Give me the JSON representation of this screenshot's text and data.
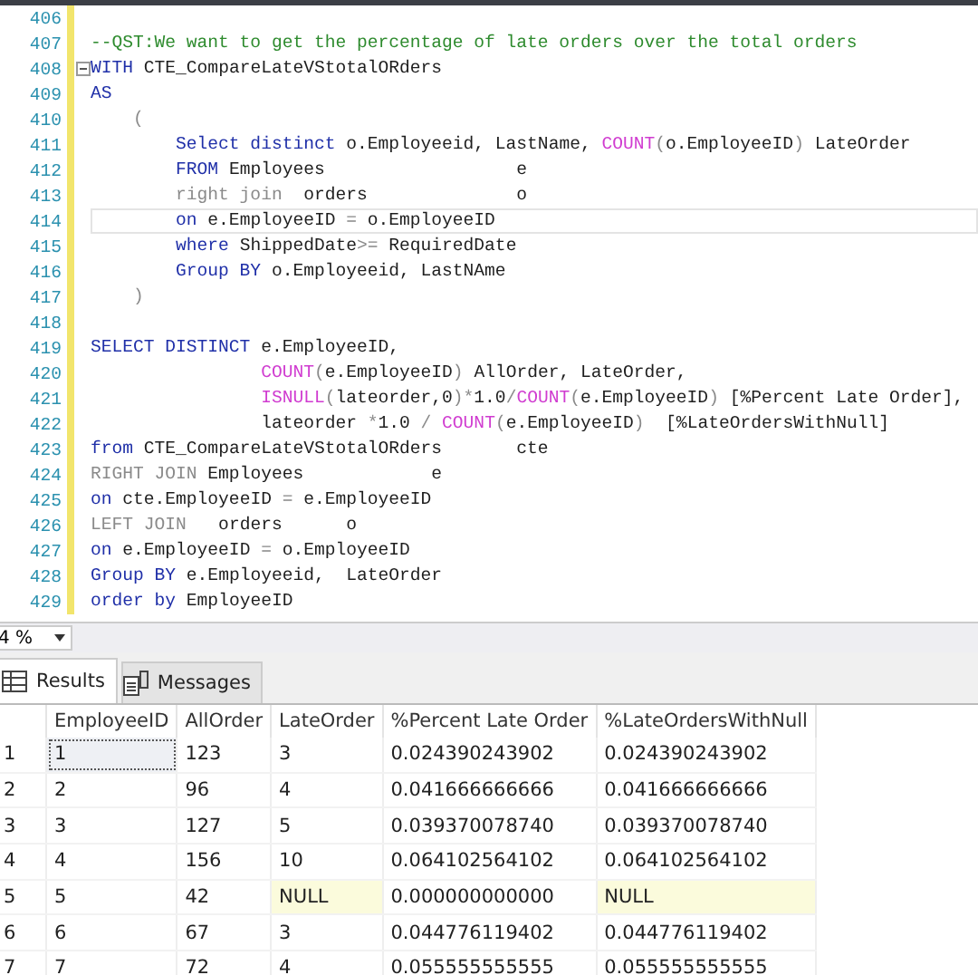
{
  "editor": {
    "lines": [
      {
        "number": "406",
        "fold": false,
        "current": false
      },
      {
        "number": "407",
        "fold": false,
        "current": false,
        "tokens": [
          {
            "kind": "comment",
            "text": "--QST:We want to get the percentage of late orders over the total orders"
          }
        ]
      },
      {
        "number": "408",
        "fold": true,
        "current": false,
        "tokens": [
          {
            "kind": "keyword",
            "text": "WITH"
          },
          {
            "kind": "plain",
            "text": " CTE_CompareLateVStotalORders"
          }
        ]
      },
      {
        "number": "409",
        "fold": false,
        "current": false,
        "tokens": [
          {
            "kind": "keyword",
            "text": "AS"
          }
        ]
      },
      {
        "number": "410",
        "fold": false,
        "current": false,
        "tokens": [
          {
            "kind": "op",
            "text": "    ("
          }
        ]
      },
      {
        "number": "411",
        "fold": false,
        "current": false,
        "tokens": [
          {
            "kind": "keyword",
            "text": "        Select distinct"
          },
          {
            "kind": "plain",
            "text": " o.Employeeid, LastName, "
          },
          {
            "kind": "function",
            "text": "COUNT"
          },
          {
            "kind": "op",
            "text": "("
          },
          {
            "kind": "plain",
            "text": "o.EmployeeID"
          },
          {
            "kind": "op",
            "text": ")"
          },
          {
            "kind": "plain",
            "text": " LateOrder"
          }
        ]
      },
      {
        "number": "412",
        "fold": false,
        "current": false,
        "tokens": [
          {
            "kind": "keyword",
            "text": "        FROM"
          },
          {
            "kind": "plain",
            "text": " Employees                  e"
          }
        ]
      },
      {
        "number": "413",
        "fold": false,
        "current": false,
        "tokens": [
          {
            "kind": "op",
            "text": "        right join"
          },
          {
            "kind": "plain",
            "text": "  orders              o"
          }
        ]
      },
      {
        "number": "414",
        "fold": false,
        "current": true,
        "tokens": [
          {
            "kind": "keyword",
            "text": "        on"
          },
          {
            "kind": "plain",
            "text": " e.EmployeeID "
          },
          {
            "kind": "op",
            "text": "="
          },
          {
            "kind": "plain",
            "text": " o.EmployeeID"
          }
        ]
      },
      {
        "number": "415",
        "fold": false,
        "current": false,
        "tokens": [
          {
            "kind": "keyword",
            "text": "        where"
          },
          {
            "kind": "plain",
            "text": " ShippedDate"
          },
          {
            "kind": "op",
            "text": ">="
          },
          {
            "kind": "plain",
            "text": " RequiredDate"
          }
        ]
      },
      {
        "number": "416",
        "fold": false,
        "current": false,
        "tokens": [
          {
            "kind": "keyword",
            "text": "        Group BY"
          },
          {
            "kind": "plain",
            "text": " o.Employeeid, LastNAme"
          }
        ]
      },
      {
        "number": "417",
        "fold": false,
        "current": false,
        "tokens": [
          {
            "kind": "op",
            "text": "    )"
          }
        ]
      },
      {
        "number": "418",
        "fold": false,
        "current": false
      },
      {
        "number": "419",
        "fold": false,
        "current": false,
        "tokens": [
          {
            "kind": "keyword",
            "text": "SELECT DISTINCT"
          },
          {
            "kind": "plain",
            "text": " e.EmployeeID,"
          }
        ]
      },
      {
        "number": "420",
        "fold": false,
        "current": false,
        "tokens": [
          {
            "kind": "function",
            "text": "                COUNT"
          },
          {
            "kind": "op",
            "text": "("
          },
          {
            "kind": "plain",
            "text": "e.EmployeeID"
          },
          {
            "kind": "op",
            "text": ")"
          },
          {
            "kind": "plain",
            "text": " AllOrder, LateOrder,"
          }
        ]
      },
      {
        "number": "421",
        "fold": false,
        "current": false,
        "tokens": [
          {
            "kind": "function",
            "text": "                ISNULL"
          },
          {
            "kind": "op",
            "text": "("
          },
          {
            "kind": "plain",
            "text": "lateorder,0"
          },
          {
            "kind": "op",
            "text": ")*"
          },
          {
            "kind": "plain",
            "text": "1.0"
          },
          {
            "kind": "op",
            "text": "/"
          },
          {
            "kind": "function",
            "text": "COUNT"
          },
          {
            "kind": "op",
            "text": "("
          },
          {
            "kind": "plain",
            "text": "e.EmployeeID"
          },
          {
            "kind": "op",
            "text": ")"
          },
          {
            "kind": "plain",
            "text": " [%Percent Late Order],"
          }
        ]
      },
      {
        "number": "422",
        "fold": false,
        "current": false,
        "tokens": [
          {
            "kind": "plain",
            "text": "                lateorder "
          },
          {
            "kind": "op",
            "text": "*"
          },
          {
            "kind": "plain",
            "text": "1.0 "
          },
          {
            "kind": "op",
            "text": "/ "
          },
          {
            "kind": "function",
            "text": "COUNT"
          },
          {
            "kind": "op",
            "text": "("
          },
          {
            "kind": "plain",
            "text": "e.EmployeeID"
          },
          {
            "kind": "op",
            "text": ")"
          },
          {
            "kind": "plain",
            "text": "  [%LateOrdersWithNull]"
          }
        ]
      },
      {
        "number": "423",
        "fold": false,
        "current": false,
        "tokens": [
          {
            "kind": "keyword",
            "text": "from"
          },
          {
            "kind": "plain",
            "text": " CTE_CompareLateVStotalORders       cte"
          }
        ]
      },
      {
        "number": "424",
        "fold": false,
        "current": false,
        "tokens": [
          {
            "kind": "op",
            "text": "RIGHT JOIN"
          },
          {
            "kind": "plain",
            "text": " Employees            e"
          }
        ]
      },
      {
        "number": "425",
        "fold": false,
        "current": false,
        "tokens": [
          {
            "kind": "keyword",
            "text": "on"
          },
          {
            "kind": "plain",
            "text": " cte.EmployeeID "
          },
          {
            "kind": "op",
            "text": "="
          },
          {
            "kind": "plain",
            "text": " e.EmployeeID"
          }
        ]
      },
      {
        "number": "426",
        "fold": false,
        "current": false,
        "tokens": [
          {
            "kind": "op",
            "text": "LEFT JOIN"
          },
          {
            "kind": "plain",
            "text": "   orders      o"
          }
        ]
      },
      {
        "number": "427",
        "fold": false,
        "current": false,
        "tokens": [
          {
            "kind": "keyword",
            "text": "on"
          },
          {
            "kind": "plain",
            "text": " e.EmployeeID "
          },
          {
            "kind": "op",
            "text": "="
          },
          {
            "kind": "plain",
            "text": " o.EmployeeID"
          }
        ]
      },
      {
        "number": "428",
        "fold": false,
        "current": false,
        "tokens": [
          {
            "kind": "keyword",
            "text": "Group BY"
          },
          {
            "kind": "plain",
            "text": " e.Employeeid,  LateOrder"
          }
        ]
      },
      {
        "number": "429",
        "fold": false,
        "current": false,
        "tokens": [
          {
            "kind": "keyword",
            "text": "order by"
          },
          {
            "kind": "plain",
            "text": " EmployeeID"
          }
        ]
      }
    ]
  },
  "zoom": {
    "value": "4 %"
  },
  "tabs": [
    {
      "label": "Results",
      "selected": true
    },
    {
      "label": "Messages",
      "selected": false
    }
  ],
  "grid": {
    "columns": [
      "EmployeeID",
      "AllOrder",
      "LateOrder",
      "%Percent Late Order",
      "%LateOrdersWithNull"
    ],
    "rows": [
      {
        "number": "1",
        "cells": [
          {
            "text": "1",
            "null": false,
            "selected": true
          },
          {
            "text": "123",
            "null": false,
            "selected": false
          },
          {
            "text": "3",
            "null": false,
            "selected": false
          },
          {
            "text": "0.024390243902",
            "null": false,
            "selected": false
          },
          {
            "text": "0.024390243902",
            "null": false,
            "selected": false
          }
        ]
      },
      {
        "number": "2",
        "cells": [
          {
            "text": "2",
            "null": false,
            "selected": false
          },
          {
            "text": "96",
            "null": false,
            "selected": false
          },
          {
            "text": "4",
            "null": false,
            "selected": false
          },
          {
            "text": "0.041666666666",
            "null": false,
            "selected": false
          },
          {
            "text": "0.041666666666",
            "null": false,
            "selected": false
          }
        ]
      },
      {
        "number": "3",
        "cells": [
          {
            "text": "3",
            "null": false,
            "selected": false
          },
          {
            "text": "127",
            "null": false,
            "selected": false
          },
          {
            "text": "5",
            "null": false,
            "selected": false
          },
          {
            "text": "0.039370078740",
            "null": false,
            "selected": false
          },
          {
            "text": "0.039370078740",
            "null": false,
            "selected": false
          }
        ]
      },
      {
        "number": "4",
        "cells": [
          {
            "text": "4",
            "null": false,
            "selected": false
          },
          {
            "text": "156",
            "null": false,
            "selected": false
          },
          {
            "text": "10",
            "null": false,
            "selected": false
          },
          {
            "text": "0.064102564102",
            "null": false,
            "selected": false
          },
          {
            "text": "0.064102564102",
            "null": false,
            "selected": false
          }
        ]
      },
      {
        "number": "5",
        "cells": [
          {
            "text": "5",
            "null": false,
            "selected": false
          },
          {
            "text": "42",
            "null": false,
            "selected": false
          },
          {
            "text": "NULL",
            "null": true,
            "selected": false
          },
          {
            "text": "0.000000000000",
            "null": false,
            "selected": false
          },
          {
            "text": "NULL",
            "null": true,
            "selected": false
          }
        ]
      },
      {
        "number": "6",
        "cells": [
          {
            "text": "6",
            "null": false,
            "selected": false
          },
          {
            "text": "67",
            "null": false,
            "selected": false
          },
          {
            "text": "3",
            "null": false,
            "selected": false
          },
          {
            "text": "0.044776119402",
            "null": false,
            "selected": false
          },
          {
            "text": "0.044776119402",
            "null": false,
            "selected": false
          }
        ]
      },
      {
        "number": "7",
        "cells": [
          {
            "text": "7",
            "null": false,
            "selected": false
          },
          {
            "text": "72",
            "null": false,
            "selected": false
          },
          {
            "text": "4",
            "null": false,
            "selected": false
          },
          {
            "text": "0.055555555555",
            "null": false,
            "selected": false
          },
          {
            "text": "0.055555555555",
            "null": false,
            "selected": false
          }
        ]
      }
    ]
  }
}
